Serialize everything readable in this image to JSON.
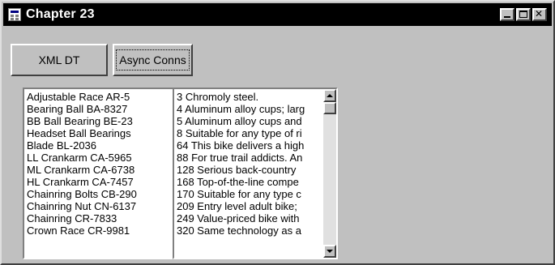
{
  "window": {
    "title": "Chapter 23"
  },
  "buttons": {
    "xml_dt": "XML DT",
    "async_conns": "Async Conns"
  },
  "list_left": {
    "items": [
      "Adjustable Race  AR-5",
      "Bearing Ball  BA-8327",
      "BB Ball Bearing  BE-23",
      "Headset Ball Bearings",
      "Blade  BL-2036",
      "LL Crankarm  CA-5965",
      "ML Crankarm  CA-6738",
      "HL Crankarm  CA-7457",
      "Chainring Bolts  CB-290",
      "Chainring Nut  CN-6137",
      "Chainring  CR-7833",
      "Crown Race  CR-9981"
    ]
  },
  "list_right": {
    "items": [
      "3  Chromoly steel.",
      "4  Aluminum alloy cups; larg",
      "5  Aluminum alloy cups and",
      "8  Suitable for any type of ri",
      "64  This bike delivers a high",
      "88  For true trail addicts.  An",
      "128  Serious back-country",
      "168  Top-of-the-line compe",
      "170  Suitable for any type c",
      "209  Entry level adult bike;",
      "249  Value-priced bike with",
      "320  Same technology as a"
    ]
  },
  "colors": {
    "face": "#c0c0c0",
    "titlebar": "#000000",
    "list_bg": "#ffffff"
  }
}
